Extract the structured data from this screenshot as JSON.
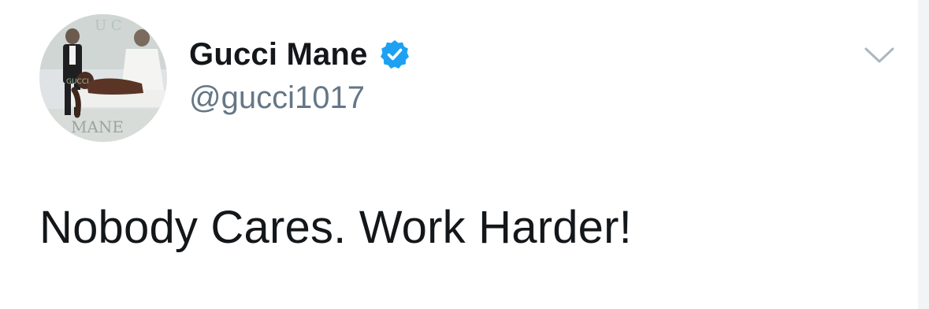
{
  "tweet": {
    "author": {
      "display_name": "Gucci Mane",
      "handle": "@gucci1017",
      "verified": true,
      "avatar_icon": "profile-photo",
      "verified_icon": "verified-badge-icon"
    },
    "text": "Nobody Cares. Work Harder!",
    "menu_icon": "chevron-down-icon"
  },
  "colors": {
    "background": "#ffffff",
    "name_text": "#14171a",
    "handle_text": "#657786",
    "verified_badge": "#1da1f2",
    "chevron": "#aab8c2"
  }
}
